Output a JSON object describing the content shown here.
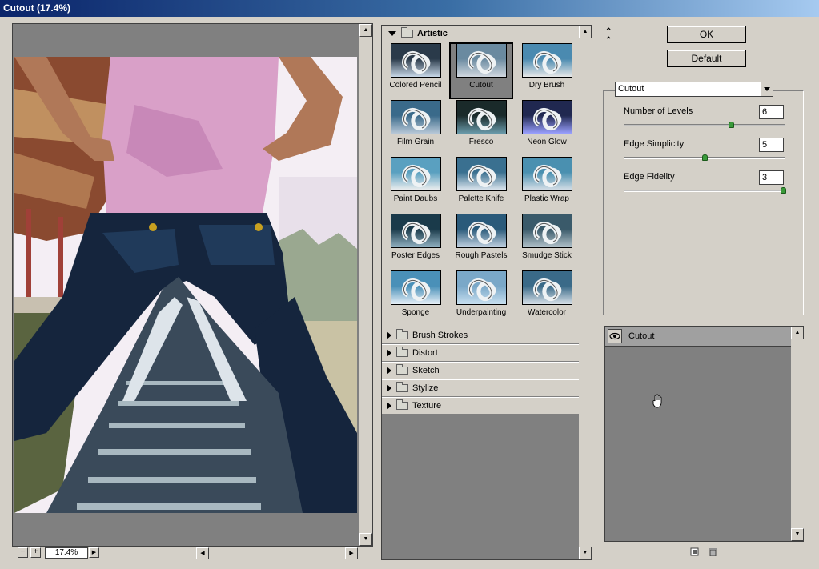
{
  "window": {
    "title": "Cutout (17.4%)"
  },
  "preview": {
    "zoom": "17.4%",
    "zoom_out": "−",
    "zoom_in": "+"
  },
  "gallery": {
    "open_category": "Artistic",
    "filters": [
      {
        "label": "Colored Pencil",
        "selected": false
      },
      {
        "label": "Cutout",
        "selected": true
      },
      {
        "label": "Dry Brush",
        "selected": false
      },
      {
        "label": "Film Grain",
        "selected": false
      },
      {
        "label": "Fresco",
        "selected": false
      },
      {
        "label": "Neon Glow",
        "selected": false
      },
      {
        "label": "Paint Daubs",
        "selected": false
      },
      {
        "label": "Palette Knife",
        "selected": false
      },
      {
        "label": "Plastic Wrap",
        "selected": false
      },
      {
        "label": "Poster Edges",
        "selected": false
      },
      {
        "label": "Rough Pastels",
        "selected": false
      },
      {
        "label": "Smudge Stick",
        "selected": false
      },
      {
        "label": "Sponge",
        "selected": false
      },
      {
        "label": "Underpainting",
        "selected": false
      },
      {
        "label": "Watercolor",
        "selected": false
      }
    ],
    "categories": [
      "Brush Strokes",
      "Distort",
      "Sketch",
      "Stylize",
      "Texture"
    ]
  },
  "buttons": {
    "ok": "OK",
    "default": "Default"
  },
  "settings": {
    "filter_select": "Cutout",
    "params": [
      {
        "label": "Number of Levels",
        "value": "6",
        "slider": 0.67
      },
      {
        "label": "Edge Simplicity",
        "value": "5",
        "slider": 0.5
      },
      {
        "label": "Edge Fidelity",
        "value": "3",
        "slider": 1.0
      }
    ]
  },
  "layers": {
    "items": [
      {
        "name": "Cutout"
      }
    ]
  }
}
